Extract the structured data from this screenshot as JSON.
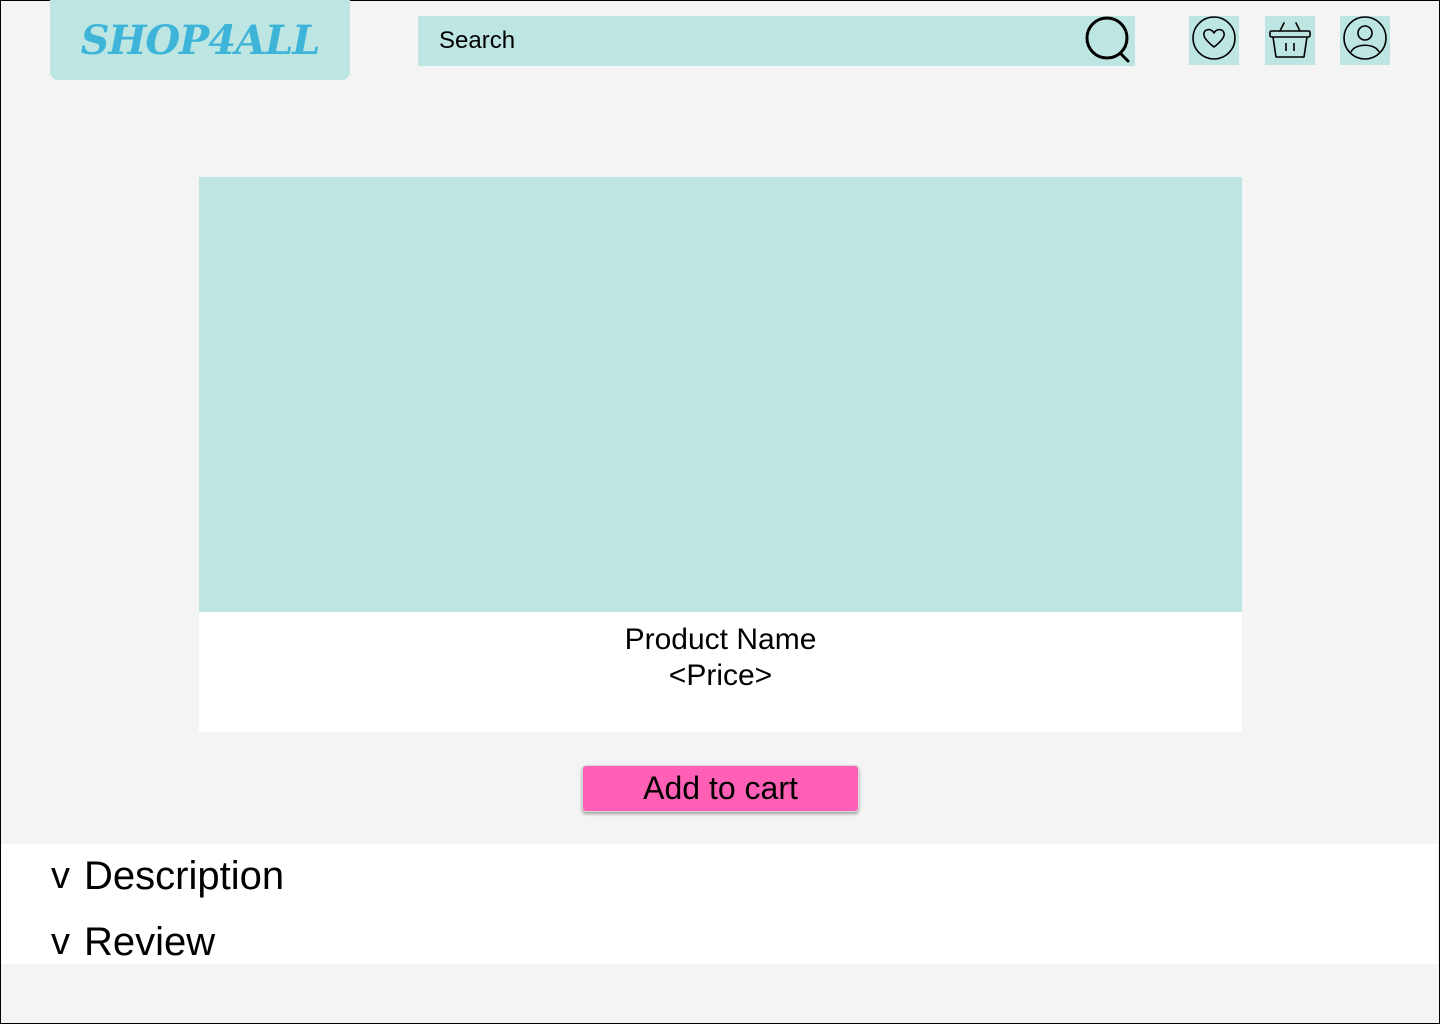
{
  "header": {
    "logo_text": "SHOP4ALL",
    "search": {
      "placeholder": "Search"
    },
    "icons": [
      "heart-icon",
      "basket-icon",
      "user-icon"
    ]
  },
  "product": {
    "name": "Product Name",
    "price": "<Price>"
  },
  "actions": {
    "add_to_cart": "Add to cart"
  },
  "accordion": {
    "chevron": "v",
    "items": [
      {
        "label": "Description"
      },
      {
        "label": "Review"
      }
    ]
  },
  "colors": {
    "page_bg": "#f4f4f4",
    "panel": "#bde6e3",
    "logo_text": "#3fb4d9",
    "primary_button": "#ff5fb5"
  }
}
